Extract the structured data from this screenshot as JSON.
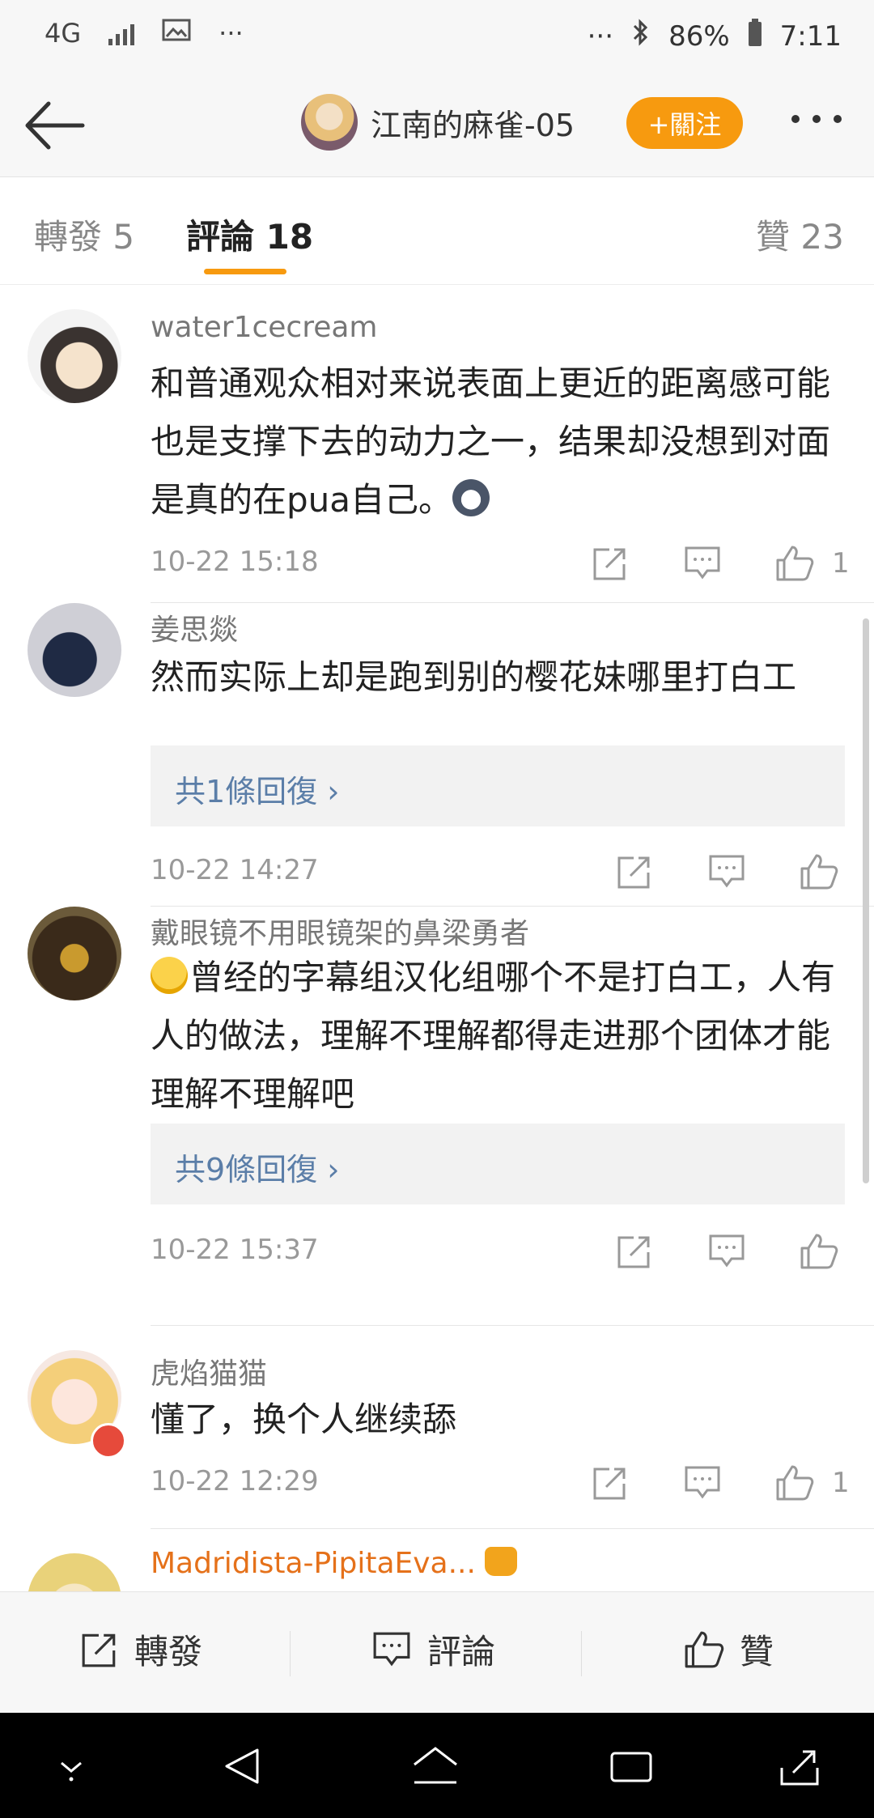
{
  "status_bar": {
    "network": "4G",
    "dots_left": "···",
    "dots_right": "···",
    "battery": "86%",
    "time": "7:11"
  },
  "header": {
    "title": "江南的麻雀-05",
    "follow_label": "+關注"
  },
  "tabs": [
    {
      "label": "轉發 5"
    },
    {
      "label": "評論 18",
      "active": true
    },
    {
      "label": "贊 23"
    }
  ],
  "comments": [
    {
      "user": "water1cecream",
      "text": "和普通观众相对来说表面上更近的距离感可能也是支撑下去的动力之一，结果却没想到对面是真的在pua自己。",
      "time": "10-22 15:18",
      "likes": "1"
    },
    {
      "user": "姜思燚",
      "text": "然而实际上却是跑到别的樱花妹哪里打白工",
      "replies": "共1條回復",
      "time": "10-22 14:27",
      "likes": ""
    },
    {
      "user": "戴眼镜不用眼镜架的鼻梁勇者",
      "text": "曾经的字幕组汉化组哪个不是打白工，人有人的做法，理解不理解都得走进那个团体才能理解不理解吧",
      "replies": "共9條回復",
      "time": "10-22 15:37",
      "likes": ""
    },
    {
      "user": "虎焰猫猫",
      "text": "懂了，换个人继续舔",
      "time": "10-22 12:29",
      "likes": "1"
    },
    {
      "user": "Madridista-PipitaEva...",
      "user_color": "#e5711a"
    }
  ],
  "bottom_bar": {
    "repost": "轉發",
    "comment": "評論",
    "like": "贊"
  },
  "colors": {
    "accent": "#f79a0f",
    "reply_link": "#5b7ea8",
    "vip_name": "#e5711a"
  }
}
